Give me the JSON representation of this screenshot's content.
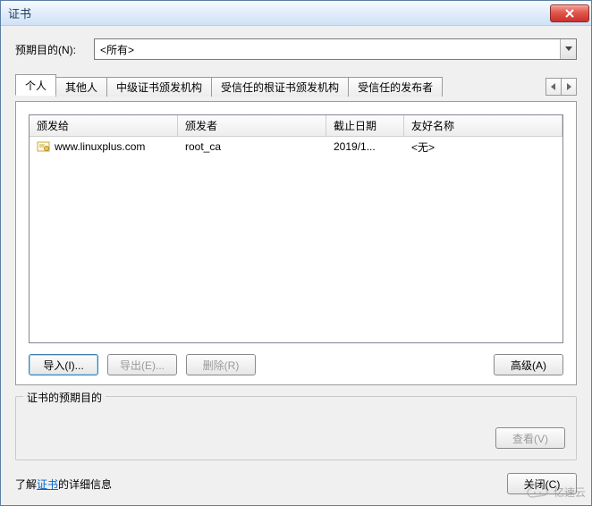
{
  "window": {
    "title": "证书"
  },
  "purpose": {
    "label": "预期目的(N):",
    "selected": "<所有>"
  },
  "tabs": {
    "items": [
      {
        "label": "个人",
        "active": true
      },
      {
        "label": "其他人",
        "active": false
      },
      {
        "label": "中级证书颁发机构",
        "active": false
      },
      {
        "label": "受信任的根证书颁发机构",
        "active": false
      },
      {
        "label": "受信任的发布者",
        "active": false
      }
    ]
  },
  "columns": {
    "issued_to": "颁发给",
    "issued_by": "颁发者",
    "expiry": "截止日期",
    "friendly": "友好名称"
  },
  "rows": [
    {
      "issued_to": "www.linuxplus.com",
      "issued_by": "root_ca",
      "expiry": "2019/1...",
      "friendly": "<无>"
    }
  ],
  "buttons": {
    "import": "导入(I)...",
    "export": "导出(E)...",
    "remove": "删除(R)",
    "advanced": "高级(A)",
    "view": "查看(V)",
    "close": "关闭(C)"
  },
  "intended": {
    "group_label": "证书的预期目的"
  },
  "footer": {
    "prefix": "了解",
    "link": "证书",
    "suffix": "的详细信息"
  },
  "watermark": "亿速云"
}
